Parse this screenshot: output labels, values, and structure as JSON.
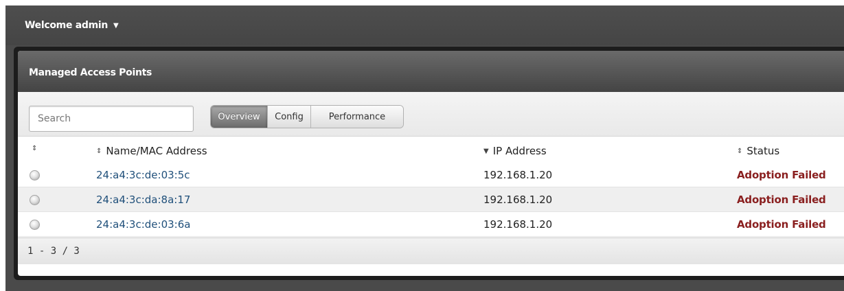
{
  "topbar": {
    "welcome_text": "Welcome admin",
    "caret": "▼"
  },
  "panel": {
    "title": "Managed Access Points"
  },
  "toolbar": {
    "search_placeholder": "Search",
    "tabs": [
      {
        "label": "Overview",
        "active": true
      },
      {
        "label": "Config",
        "active": false
      },
      {
        "label": "Performance",
        "active": false
      }
    ]
  },
  "table": {
    "columns": {
      "led": {
        "sort_icon": "⇕",
        "label": ""
      },
      "name": {
        "sort_icon": "⇕",
        "label": "Name/MAC Address"
      },
      "ip": {
        "sort_icon": "▼",
        "label": "IP Address"
      },
      "status": {
        "sort_icon": "⇕",
        "label": "Status"
      }
    },
    "rows": [
      {
        "led_icon": "gray-status-led-icon",
        "mac": "24:a4:3c:de:03:5c",
        "ip": "192.168.1.20",
        "status": "Adoption Failed"
      },
      {
        "led_icon": "gray-status-led-icon",
        "mac": "24:a4:3c:da:8a:17",
        "ip": "192.168.1.20",
        "status": "Adoption Failed"
      },
      {
        "led_icon": "gray-status-led-icon",
        "mac": "24:a4:3c:de:03:6a",
        "ip": "192.168.1.20",
        "status": "Adoption Failed"
      }
    ]
  },
  "footer": {
    "pagination": "1 - 3 / 3"
  },
  "colors": {
    "status_failed": "#8a1f1f",
    "mac_link": "#1f4f7a",
    "active_tab": "#6c6c6c"
  }
}
